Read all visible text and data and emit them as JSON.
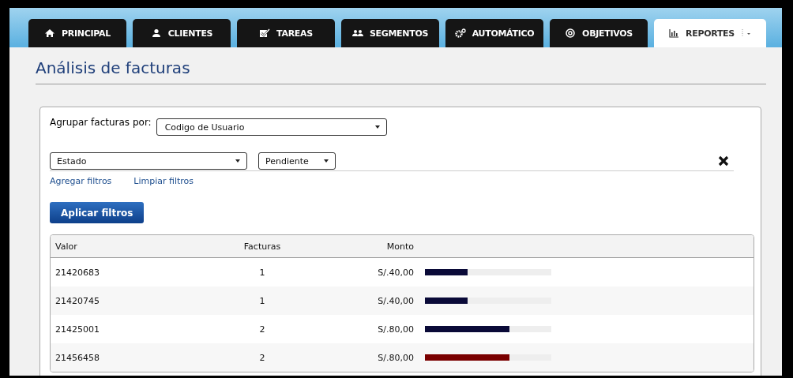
{
  "tabs": [
    {
      "label": "PRINCIPAL",
      "selected": false
    },
    {
      "label": "CLIENTES",
      "selected": false
    },
    {
      "label": "TAREAS",
      "selected": false
    },
    {
      "label": "SEGMENTOS",
      "selected": false
    },
    {
      "label": "AUTOMÁTICO",
      "selected": false
    },
    {
      "label": "OBJETIVOS",
      "selected": false
    },
    {
      "label": "REPORTES",
      "selected": true
    }
  ],
  "title": "Análisis de facturas",
  "group_by": {
    "label": "Agrupar facturas por:",
    "value": "Codigo de Usuario"
  },
  "filter": {
    "field": "Estado",
    "value": "Pendiente"
  },
  "links": [
    "Agregar filtros",
    "Limpiar filtros"
  ],
  "apply_button": "Aplicar filtros",
  "table": {
    "columns": [
      "Valor",
      "Facturas",
      "Monto"
    ],
    "rows": [
      {
        "valor": "21420683",
        "facturas": "1",
        "monto": "S/.40,00",
        "level": 0.34,
        "color": "#0a0a38"
      },
      {
        "valor": "21420745",
        "facturas": "1",
        "monto": "S/.40,00",
        "level": 0.34,
        "color": "#0a0a38"
      },
      {
        "valor": "21425001",
        "facturas": "2",
        "monto": "S/.80,00",
        "level": 0.67,
        "color": "#0a0a38"
      },
      {
        "valor": "21456458",
        "facturas": "2",
        "monto": "S/.80,00",
        "level": 0.67,
        "color": "#7a0000"
      }
    ]
  }
}
